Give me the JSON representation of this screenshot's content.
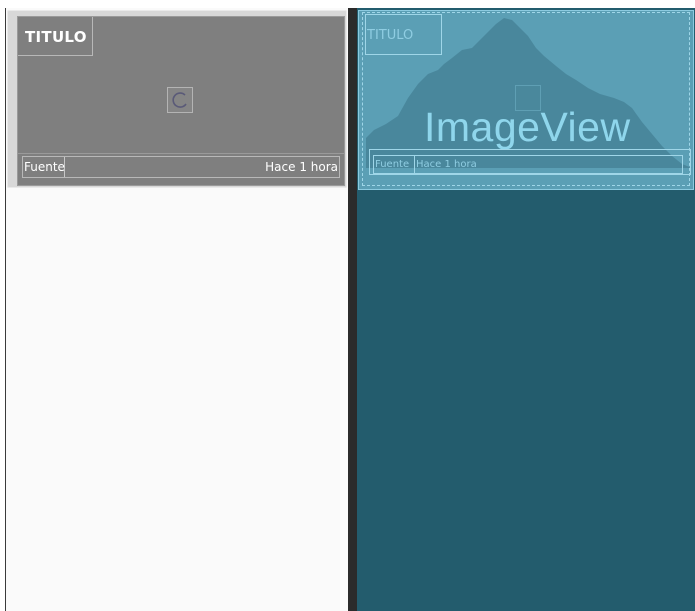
{
  "design_view": {
    "card": {
      "title": "TITULO",
      "source_label": "Fuente",
      "time_label": "Hace 1 hora"
    },
    "spinner_icon": "progress-spinner-icon"
  },
  "blueprint_view": {
    "card": {
      "title": "TITULO",
      "image_label": "ImageView",
      "source_label": "Fuente",
      "time_label": "Hace 1 hora"
    },
    "image_icon": "mountain-placeholder-icon"
  },
  "colors": {
    "design_background": "#fafafa",
    "card_background": "#7f7f7f",
    "blueprint_background": "#235c6d",
    "blueprint_card": "#5b9fb5",
    "blueprint_accent": "#8fd6ec",
    "divider": "#2b2b2b"
  }
}
